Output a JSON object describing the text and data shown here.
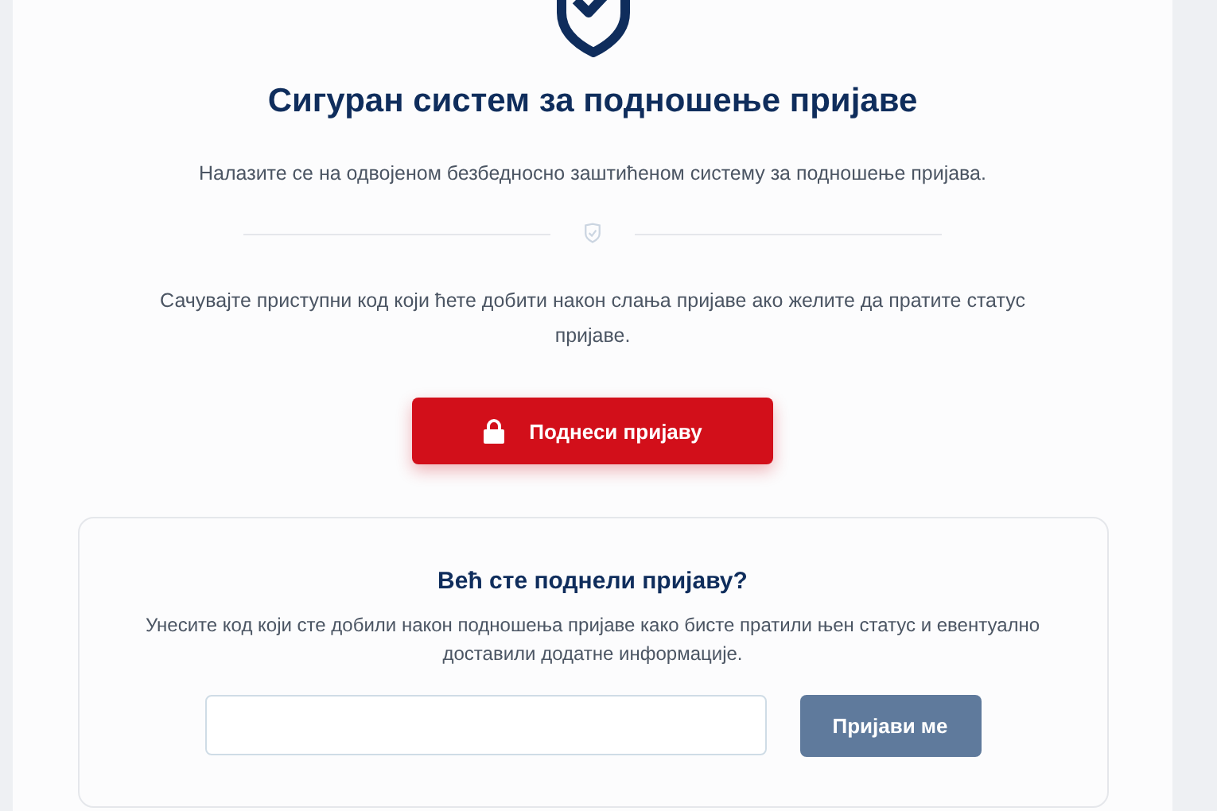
{
  "header": {
    "title": "Сигуран систем за подношење пријаве",
    "subtitle": "Налазите се на одвојеном безбедносно заштићеном систему за подношење пријава.",
    "note": "Сачувајте приступни код који ћете добити након слања пријаве ако желите да пратите статус пријаве.",
    "submit_button": "Поднеси пријаву"
  },
  "track_panel": {
    "title": "Већ сте поднели пријаву?",
    "text": "Унесите код који сте добили након подношења пријаве како бисте пратили њен статус и евентуално доставили додатне информације.",
    "login_button": "Пријави ме"
  }
}
